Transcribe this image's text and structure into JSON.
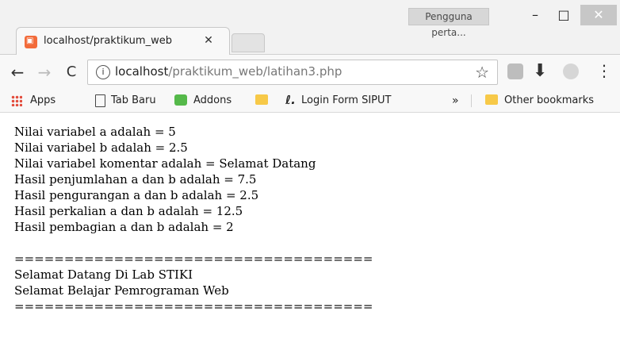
{
  "window": {
    "profile": "Pengguna perta...",
    "minimize": "–",
    "maximize": "□",
    "close": "✕"
  },
  "tab": {
    "title": "localhost/praktikum_web",
    "close": "✕"
  },
  "toolbar": {
    "back": "←",
    "forward": "→",
    "reload": "C",
    "info": "i",
    "url_host": "localhost",
    "url_path": "/praktikum_web/latihan3.php",
    "star": "☆",
    "download": "⬇",
    "menu": "⋮"
  },
  "bookmarks": {
    "apps": "Apps",
    "tab_baru": "Tab Baru",
    "addons": "Addons",
    "login_icon": "ℓ.",
    "login": "Login Form SIPUT",
    "more": "»",
    "other": "Other bookmarks"
  },
  "content": {
    "lines": [
      "Nilai variabel a adalah = 5",
      "Nilai variabel b adalah = 2.5",
      "Nilai variabel komentar adalah = Selamat Datang",
      "Hasil penjumlahan a dan b adalah = 7.5",
      "Hasil pengurangan a dan b adalah = 2.5",
      "Hasil perkalian a dan b adalah = 12.5",
      "Hasil pembagian a dan b adalah = 2"
    ],
    "separator": "====================================",
    "greeting1": "Selamat Datang Di Lab STIKI",
    "greeting2": "Selamat Belajar Pemrograman Web"
  }
}
